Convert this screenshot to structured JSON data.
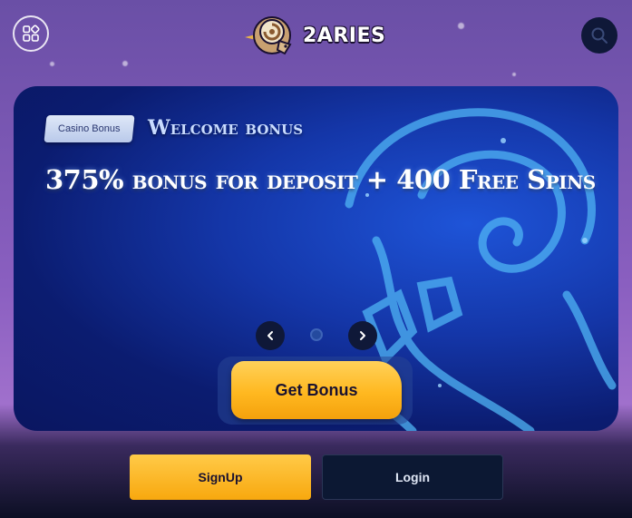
{
  "header": {
    "brand": "2ARIES",
    "menu_icon": "grid-icon",
    "search_icon": "search-icon"
  },
  "banner": {
    "badge": "Casino Bonus",
    "title": "Welcome bonus",
    "headline": "375% bonus for deposit + 400 Free Spins",
    "cta": "Get Bonus",
    "prev_icon": "chevron-left-icon",
    "next_icon": "chevron-right-icon"
  },
  "auth": {
    "signup_label": "SignUp",
    "login_label": "Login"
  },
  "colors": {
    "accent": "#ffb820",
    "banner_blue": "#1436a8",
    "dark_button": "#0c1833"
  }
}
